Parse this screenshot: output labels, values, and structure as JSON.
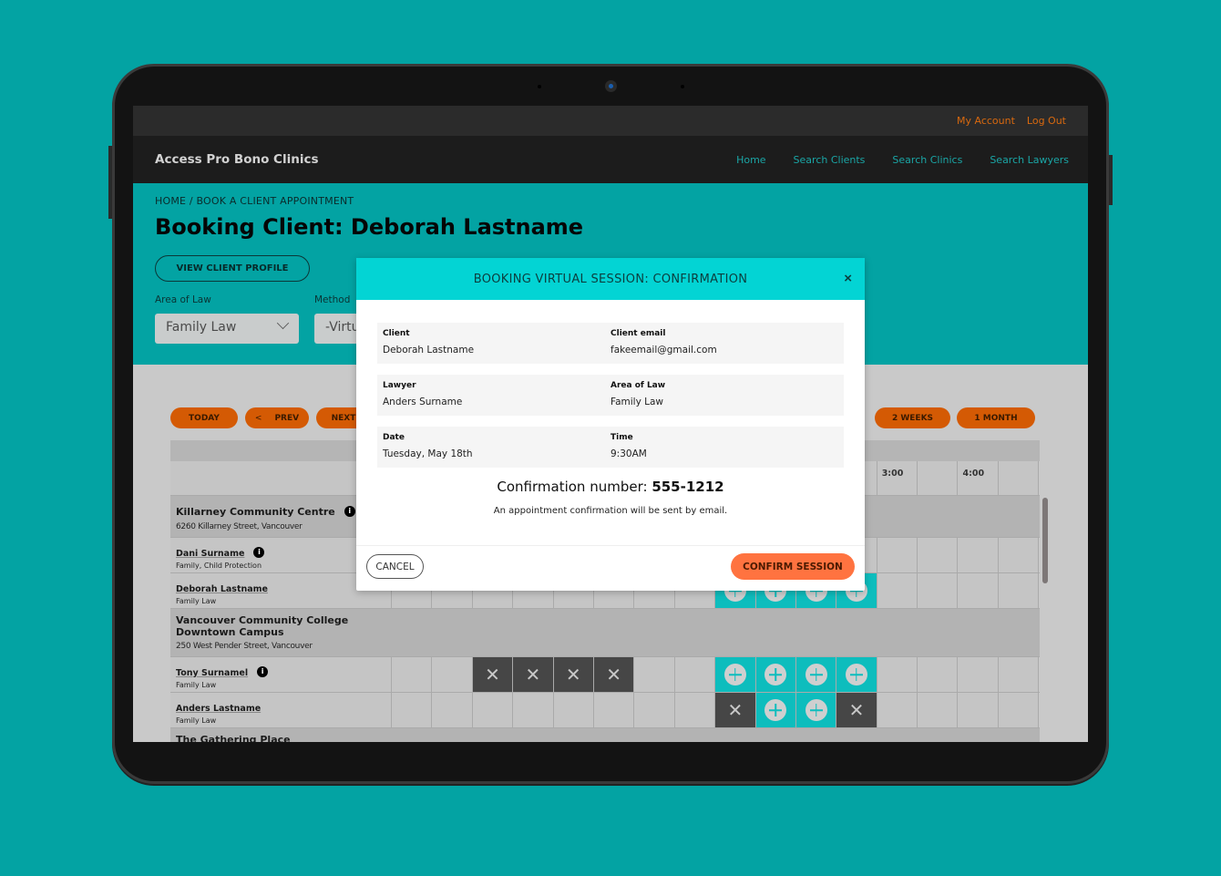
{
  "header": {
    "account_links": [
      "My Account",
      "Log Out"
    ],
    "brand": "Access Pro Bono Clinics",
    "nav": [
      "Home",
      "Search Clients",
      "Search Clinics",
      "Search Lawyers"
    ]
  },
  "page": {
    "breadcrumb": "HOME / BOOK A CLIENT APPOINTMENT",
    "title": "Booking Client: Deborah Lastname",
    "view_profile_label": "VIEW CLIENT PROFILE",
    "area_of_law_label": "Area of Law",
    "area_of_law_value": "Family Law",
    "method_label": "Method",
    "method_value": "-Virtu"
  },
  "calendar": {
    "buttons": {
      "today": "TODAY",
      "prev": "PREV",
      "next": "NEXT",
      "two_weeks": "2 WEEKS",
      "one_month": "1 MONTH"
    },
    "time_headers": [
      "",
      "",
      "",
      "",
      "",
      "",
      "",
      "",
      "",
      "",
      "",
      "",
      "3:00",
      "",
      "4:00",
      ""
    ],
    "clinics": [
      {
        "name": "Killarney Community Centre",
        "address": "6260 Killarney Street, Vancouver",
        "lawyers": [
          {
            "name": "Dani Surname",
            "area": "Family, Child Protection",
            "info": true,
            "slots": [
              "",
              "",
              "",
              "",
              "",
              "",
              "",
              "",
              "",
              "",
              "",
              "",
              "",
              "",
              "",
              ""
            ]
          },
          {
            "name": "Deborah Lastname",
            "area": "Family Law",
            "info": false,
            "slots": [
              "",
              "",
              "",
              "",
              "",
              "",
              "",
              "",
              "avail",
              "avail",
              "avail",
              "avail",
              "",
              "",
              "",
              ""
            ]
          }
        ]
      },
      {
        "name": "Vancouver Community College Downtown Campus",
        "address": "250 West Pender Street, Vancouver",
        "lawyers": [
          {
            "name": "Tony Surnamel",
            "area": "Family Law",
            "info": true,
            "slots": [
              "",
              "",
              "booked",
              "booked",
              "booked",
              "booked",
              "",
              "",
              "avail",
              "avail",
              "avail",
              "avail",
              "",
              "",
              "",
              ""
            ]
          },
          {
            "name": "Anders Lastname",
            "area": "Family Law",
            "info": false,
            "slots": [
              "",
              "",
              "",
              "",
              "",
              "",
              "",
              "",
              "booked",
              "avail",
              "avail",
              "booked",
              "",
              "",
              "",
              ""
            ]
          }
        ]
      },
      {
        "name": "The Gathering Place",
        "address": "",
        "lawyers": []
      }
    ]
  },
  "modal": {
    "title": "BOOKING VIRTUAL SESSION: CONFIRMATION",
    "close_icon": "×",
    "fields": [
      [
        {
          "label": "Client",
          "value": "Deborah Lastname"
        },
        {
          "label": "Client email",
          "value": "fakeemail@gmail.com"
        }
      ],
      [
        {
          "label": "Lawyer",
          "value": "Anders Surname"
        },
        {
          "label": "Area of Law",
          "value": "Family Law"
        }
      ],
      [
        {
          "label": "Date",
          "value": "Tuesday, May 18th"
        },
        {
          "label": "Time",
          "value": "9:30AM"
        }
      ]
    ],
    "confirmation_label": "Confirmation number:",
    "confirmation_number": "555-1212",
    "note": "An appointment confirmation will be sent by email.",
    "cancel_label": "CANCEL",
    "confirm_label": "CONFIRM SESSION"
  },
  "colors": {
    "teal": "#03a3a3",
    "modal_header": "#03d4d4",
    "orange": "#d45a04",
    "confirm": "#ff7340",
    "available": "#0dbdbd",
    "booked": "#464646"
  }
}
